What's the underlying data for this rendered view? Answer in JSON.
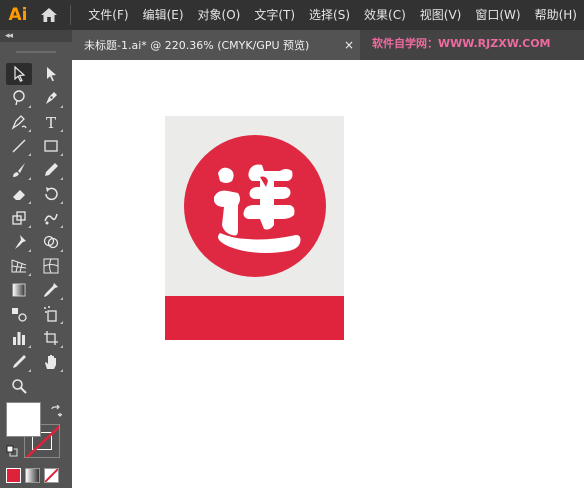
{
  "app": {
    "logo_text": "Ai"
  },
  "menu": {
    "items": [
      {
        "label": "文件(F)"
      },
      {
        "label": "编辑(E)"
      },
      {
        "label": "对象(O)"
      },
      {
        "label": "文字(T)"
      },
      {
        "label": "选择(S)"
      },
      {
        "label": "效果(C)"
      },
      {
        "label": "视图(V)"
      },
      {
        "label": "窗口(W)"
      },
      {
        "label": "帮助(H)"
      }
    ]
  },
  "toolpanel": {
    "collapse_label": "◂◂",
    "fill_color": "#ffffff",
    "stroke": "none",
    "tools": [
      {
        "name": "selection-tool-icon",
        "active": true
      },
      {
        "name": "direct-selection-tool-icon"
      },
      {
        "name": "magic-wand-tool-icon"
      },
      {
        "name": "lasso-tool-icon"
      },
      {
        "name": "pen-tool-icon"
      },
      {
        "name": "type-tool-icon",
        "glyph": "T"
      },
      {
        "name": "line-segment-tool-icon"
      },
      {
        "name": "rectangle-tool-icon"
      },
      {
        "name": "paintbrush-tool-icon"
      },
      {
        "name": "pencil-tool-icon"
      },
      {
        "name": "eraser-tool-icon"
      },
      {
        "name": "rotate-tool-icon"
      },
      {
        "name": "scale-tool-icon"
      },
      {
        "name": "warp-tool-icon"
      },
      {
        "name": "puppet-warp-tool-icon"
      },
      {
        "name": "shape-builder-tool-icon"
      },
      {
        "name": "perspective-grid-tool-icon"
      },
      {
        "name": "mesh-tool-icon"
      },
      {
        "name": "gradient-tool-icon"
      },
      {
        "name": "eyedropper-tool-icon"
      },
      {
        "name": "blend-tool-icon"
      },
      {
        "name": "symbol-sprayer-tool-icon"
      },
      {
        "name": "column-graph-tool-icon"
      },
      {
        "name": "artboard-tool-icon"
      },
      {
        "name": "slice-tool-icon"
      },
      {
        "name": "hand-tool-icon"
      },
      {
        "name": "zoom-tool-icon"
      }
    ]
  },
  "document_tab": {
    "title": "未标题-1.ai* @ 220.36% (CMYK/GPU 预览)",
    "close_label": "×"
  },
  "watermark": {
    "text": "软件自学网：WWW.RJZXW.COM"
  },
  "artwork": {
    "background_color": "#ebebe9",
    "circle_color": "#df2841",
    "bar_color": "#e0243e",
    "glyph_color": "#ffffff"
  }
}
